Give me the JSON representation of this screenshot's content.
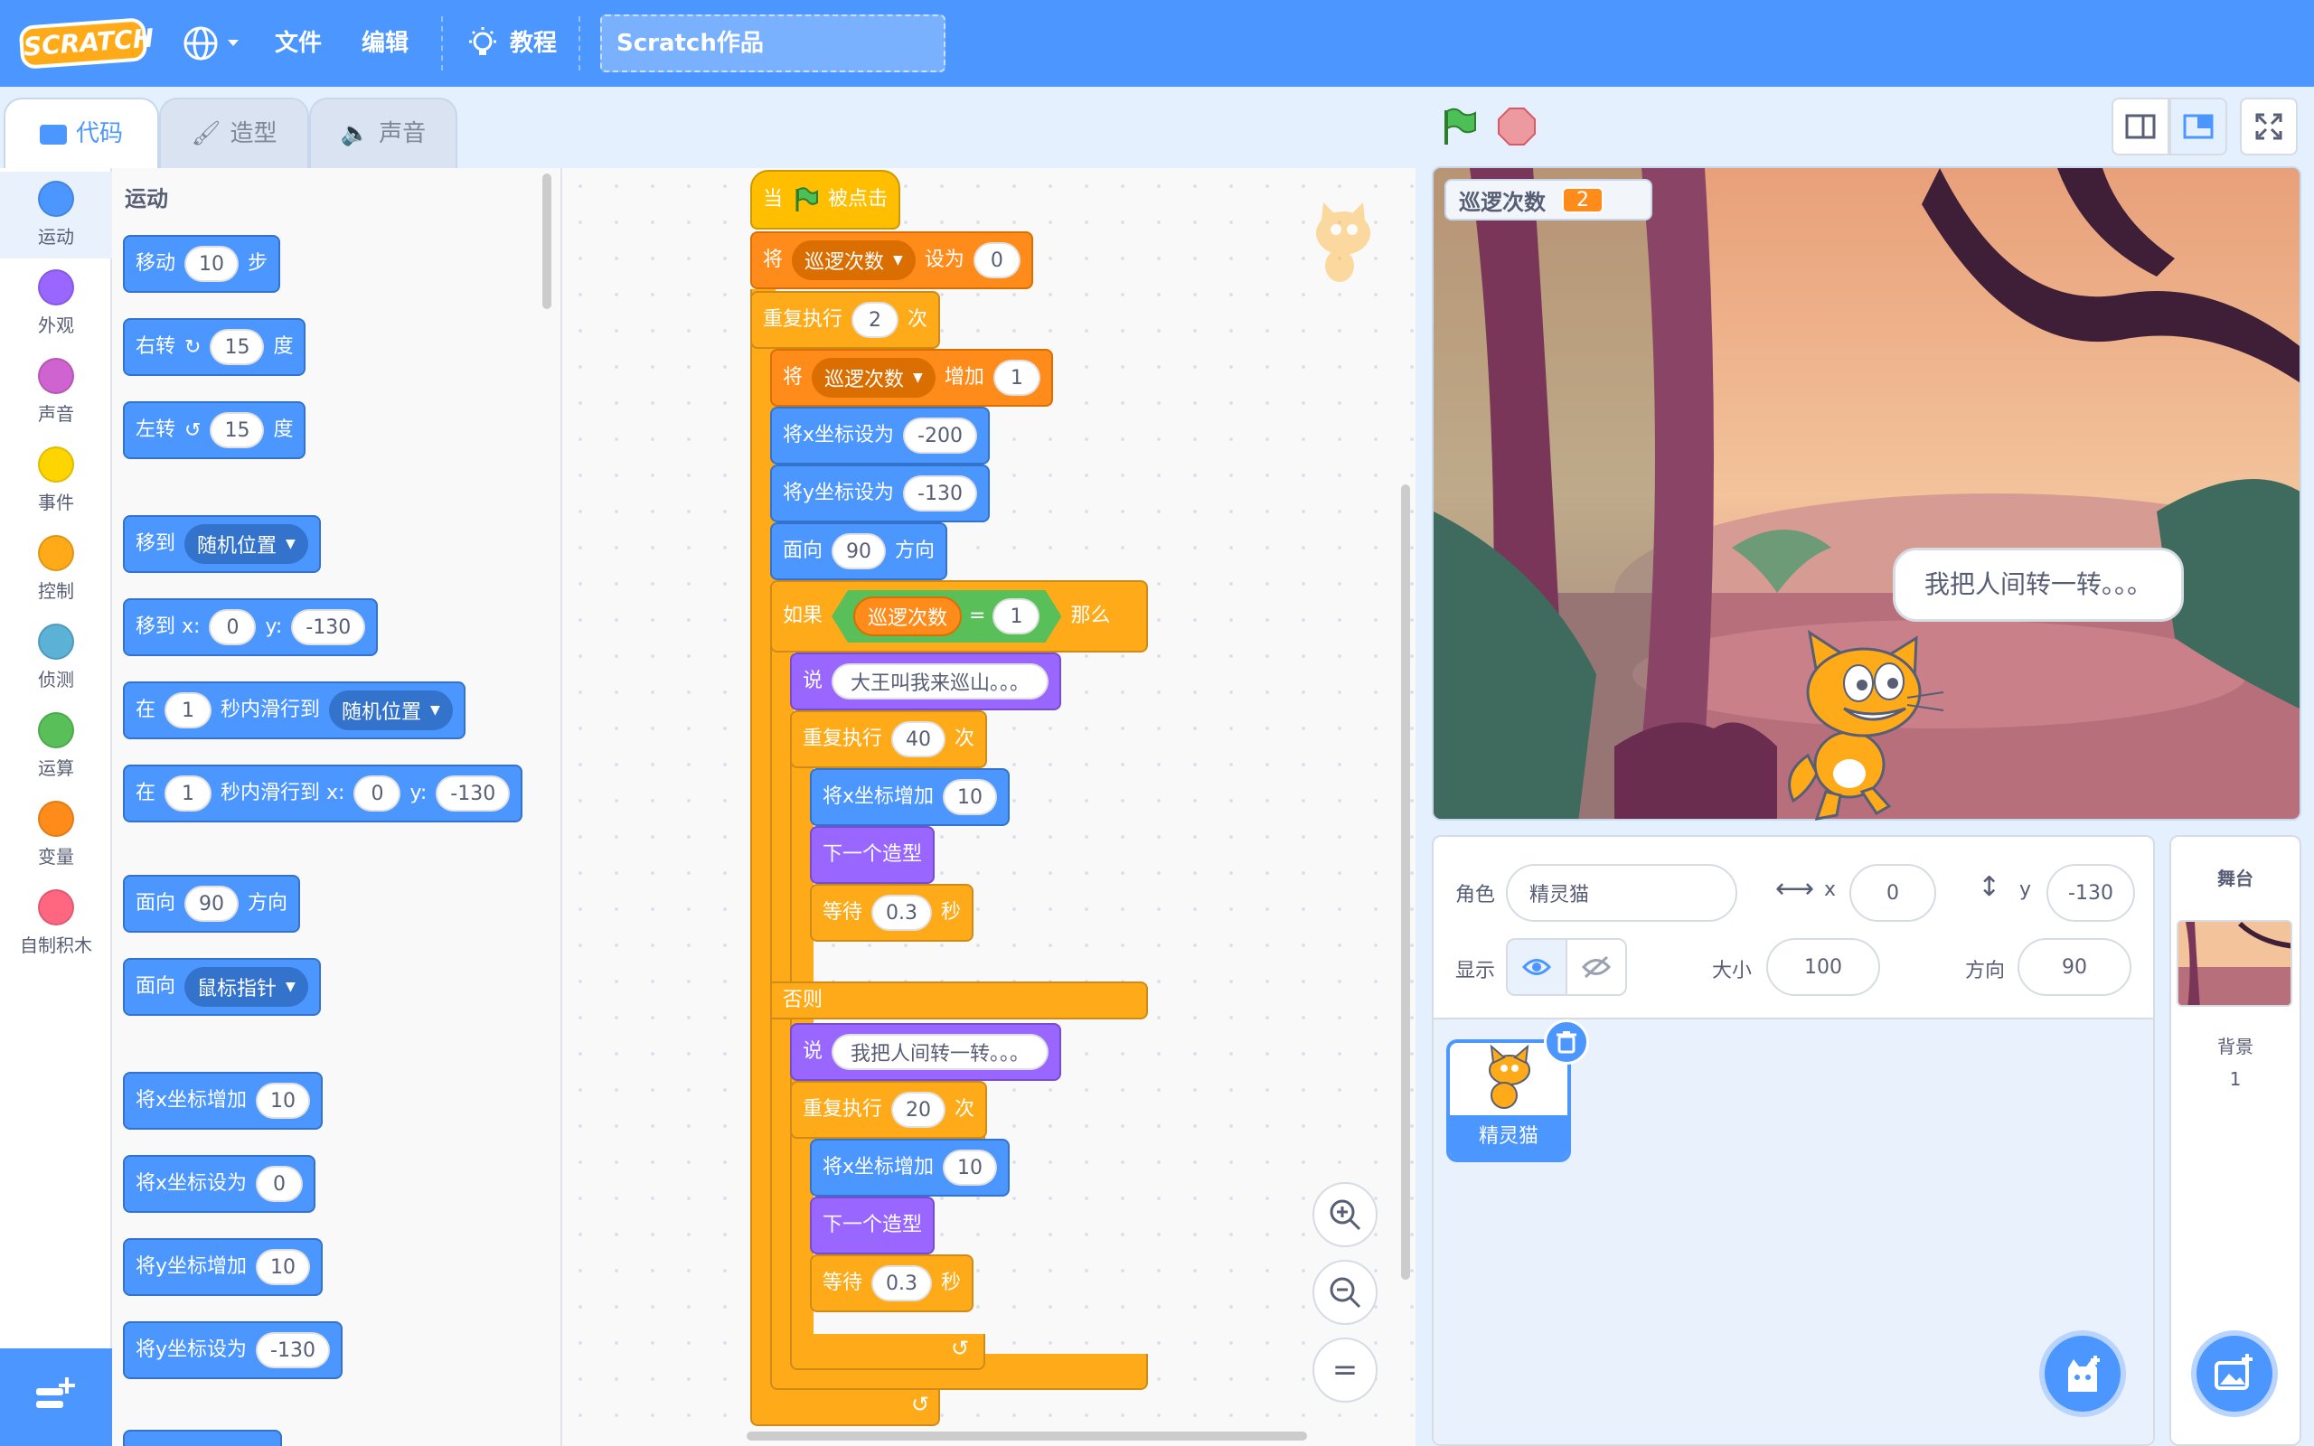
{
  "menu": {
    "logo": "SCRATCH",
    "file": "文件",
    "edit": "编辑",
    "tutorials": "教程",
    "project_title": "Scratch作品"
  },
  "tabs": {
    "code": "代码",
    "costumes": "造型",
    "sounds": "声音"
  },
  "categories": [
    {
      "label": "运动",
      "color": "#4c97ff"
    },
    {
      "label": "外观",
      "color": "#9966ff"
    },
    {
      "label": "声音",
      "color": "#cf63cf"
    },
    {
      "label": "事件",
      "color": "#ffd500"
    },
    {
      "label": "控制",
      "color": "#ffab19"
    },
    {
      "label": "侦测",
      "color": "#5cb1d6"
    },
    {
      "label": "运算",
      "color": "#59c059"
    },
    {
      "label": "变量",
      "color": "#ff8c1a"
    },
    {
      "label": "自制积木",
      "color": "#ff6680"
    }
  ],
  "palette": {
    "section": "运动",
    "move": {
      "a": "移动",
      "v": "10",
      "b": "步"
    },
    "turn_right": {
      "a": "右转",
      "v": "15",
      "b": "度"
    },
    "turn_left": {
      "a": "左转",
      "v": "15",
      "b": "度"
    },
    "goto": {
      "a": "移到",
      "d": "随机位置"
    },
    "goto_xy": {
      "a": "移到 x:",
      "x": "0",
      "y_l": "y:",
      "y": "-130"
    },
    "glide": {
      "a": "在",
      "v": "1",
      "b": "秒内滑行到",
      "d": "随机位置"
    },
    "glide_xy": {
      "a": "在",
      "v": "1",
      "b": "秒内滑行到 x:",
      "x": "0",
      "y_l": "y:",
      "y": "-130"
    },
    "point_dir": {
      "a": "面向",
      "v": "90",
      "b": "方向"
    },
    "point_towards": {
      "a": "面向",
      "d": "鼠标指针"
    },
    "change_x": {
      "a": "将x坐标增加",
      "v": "10"
    },
    "set_x": {
      "a": "将x坐标设为",
      "v": "0"
    },
    "change_y": {
      "a": "将y坐标增加",
      "v": "10"
    },
    "set_y": {
      "a": "将y坐标设为",
      "v": "-130"
    }
  },
  "script": {
    "hat": {
      "a": "当",
      "b": "被点击"
    },
    "set_var": {
      "a": "将",
      "var": "巡逻次数",
      "b": "设为",
      "v": "0"
    },
    "repeat_outer": {
      "a": "重复执行",
      "v": "2",
      "b": "次"
    },
    "change_var": {
      "a": "将",
      "var": "巡逻次数",
      "b": "增加",
      "v": "1"
    },
    "set_x": {
      "a": "将x坐标设为",
      "v": "-200"
    },
    "set_y": {
      "a": "将y坐标设为",
      "v": "-130"
    },
    "point": {
      "a": "面向",
      "v": "90",
      "b": "方向"
    },
    "if": {
      "a": "如果",
      "var": "巡逻次数",
      "op": "=",
      "v": "1",
      "b": "那么"
    },
    "say1": {
      "a": "说",
      "v": "大王叫我来巡山。。。"
    },
    "repeat1": {
      "a": "重复执行",
      "v": "40",
      "b": "次"
    },
    "change_x1": {
      "a": "将x坐标增加",
      "v": "10"
    },
    "next1": {
      "a": "下一个造型"
    },
    "wait1": {
      "a": "等待",
      "v": "0.3",
      "b": "秒"
    },
    "else": "否则",
    "say2": {
      "a": "说",
      "v": "我把人间转一转。。。"
    },
    "repeat2": {
      "a": "重复执行",
      "v": "20",
      "b": "次"
    },
    "change_x2": {
      "a": "将x坐标增加",
      "v": "10"
    },
    "next2": {
      "a": "下一个造型"
    },
    "wait2": {
      "a": "等待",
      "v": "0.3",
      "b": "秒"
    }
  },
  "stage": {
    "monitor_label": "巡逻次数",
    "monitor_value": "2",
    "speech": "我把人间转一转。。。"
  },
  "sprite_info": {
    "sprite_label": "角色",
    "sprite_name": "精灵猫",
    "x_label": "x",
    "x": "0",
    "y_label": "y",
    "y": "-130",
    "show_label": "显示",
    "size_label": "大小",
    "size": "100",
    "direction_label": "方向",
    "direction": "90"
  },
  "sprites": [
    {
      "name": "精灵猫"
    }
  ],
  "stage_panel": {
    "title": "舞台",
    "backdrops_label": "背景",
    "backdrops_count": "1"
  }
}
